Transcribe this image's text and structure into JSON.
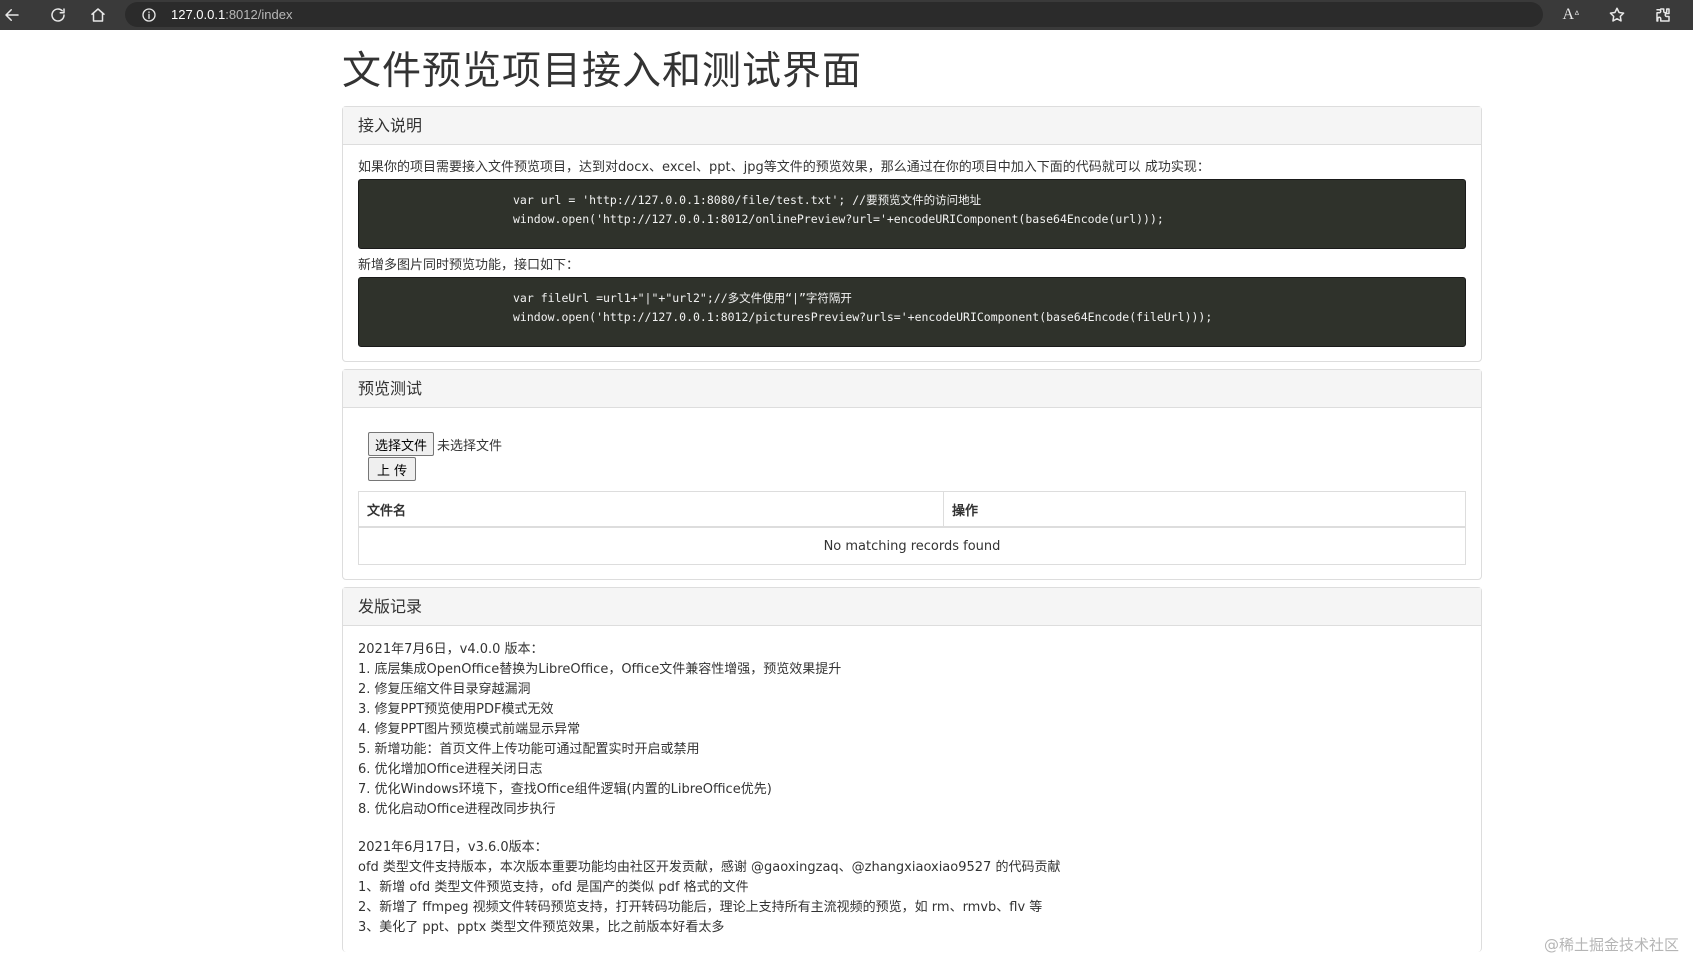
{
  "browser": {
    "url_host": "127.0.0.1",
    "url_rest": ":8012/index",
    "icons": [
      "back-arrow-icon",
      "reload-icon",
      "home-icon",
      "info-icon",
      "read-aloud-icon",
      "favorite-star-icon",
      "extensions-icon"
    ]
  },
  "page": {
    "title": "文件预览项目接入和测试界面"
  },
  "integration": {
    "heading": "接入说明",
    "intro": "如果你的项目需要接入文件预览项目，达到对docx、excel、ppt、jpg等文件的预览效果，那么通过在你的项目中加入下面的代码就可以 成功实现：",
    "code1_line1": "var url = 'http://127.0.0.1:8080/file/test.txt'; //要预览文件的访问地址",
    "code1_line2": "window.open('http://127.0.0.1:8012/onlinePreview?url='+encodeURIComponent(base64Encode(url)));",
    "multi_intro": "新增多图片同时预览功能，接口如下：",
    "code2_line1": "var fileUrl =url1+\"|\"+\"url2\";//多文件使用“|”字符隔开",
    "code2_line2": "window.open('http://127.0.0.1:8012/picturesPreview?urls='+encodeURIComponent(base64Encode(fileUrl)));"
  },
  "preview_test": {
    "heading": "预览测试",
    "choose_file_label": "选择文件",
    "no_file_text": "未选择文件",
    "upload_label": "上 传",
    "table": {
      "col_filename": "文件名",
      "col_action": "操作",
      "empty_text": "No matching records found"
    }
  },
  "release_log": {
    "heading": "发版记录",
    "v400_title": "2021年7月6日，v4.0.0 版本：",
    "v400_items": [
      "1. 底层集成OpenOffice替换为LibreOffice，Office文件兼容性增强，预览效果提升",
      "2. 修复压缩文件目录穿越漏洞",
      "3. 修复PPT预览使用PDF模式无效",
      "4. 修复PPT图片预览模式前端显示异常",
      "5. 新增功能：首页文件上传功能可通过配置实时开启或禁用",
      "6. 优化增加Office进程关闭日志",
      "7. 优化Windows环境下，查找Office组件逻辑(内置的LibreOffice优先)",
      "8. 优化启动Office进程改同步执行"
    ],
    "v360_title": "2021年6月17日，v3.6.0版本：",
    "v360_intro": "ofd 类型文件支持版本，本次版本重要功能均由社区开发贡献，感谢 @gaoxingzaq、@zhangxiaoxiao9527 的代码贡献",
    "v360_items": [
      "1、新增 ofd 类型文件预览支持，ofd 是国产的类似 pdf 格式的文件",
      "2、新增了 ffmpeg 视频文件转码预览支持，打开转码功能后，理论上支持所有主流视频的预览，如 rm、rmvb、flv 等",
      "3、美化了 ppt、pptx 类型文件预览效果，比之前版本好看太多"
    ]
  },
  "watermark": "@稀土掘金技术社区"
}
